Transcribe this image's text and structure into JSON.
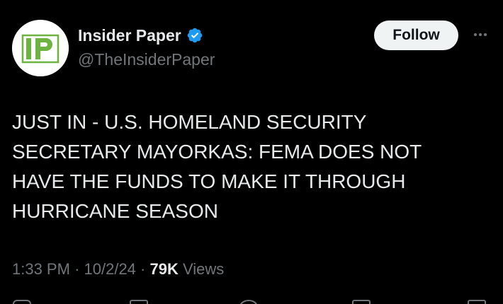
{
  "account": {
    "display_name": "Insider Paper",
    "handle": "@TheInsiderPaper",
    "verified": true,
    "avatar_letters": "IP",
    "verified_badge_color": "#1d9bf0",
    "avatar_accent_color": "#6db33f"
  },
  "header": {
    "follow_label": "Follow",
    "more_icon": "more-horizontal-icon"
  },
  "tweet": {
    "text": "JUST IN - U.S. HOMELAND SECURITY\nSECRETARY MAYORKAS: FEMA DOES NOT\nHAVE THE FUNDS TO MAKE IT THROUGH\nHURRICANE SEASON"
  },
  "meta": {
    "time": "1:33 PM",
    "separator": "·",
    "date": "10/2/24",
    "views_count": "79K",
    "views_label": "Views"
  },
  "actions": [
    "reply-icon",
    "repost-icon",
    "like-icon",
    "bookmark-icon",
    "share-icon"
  ]
}
